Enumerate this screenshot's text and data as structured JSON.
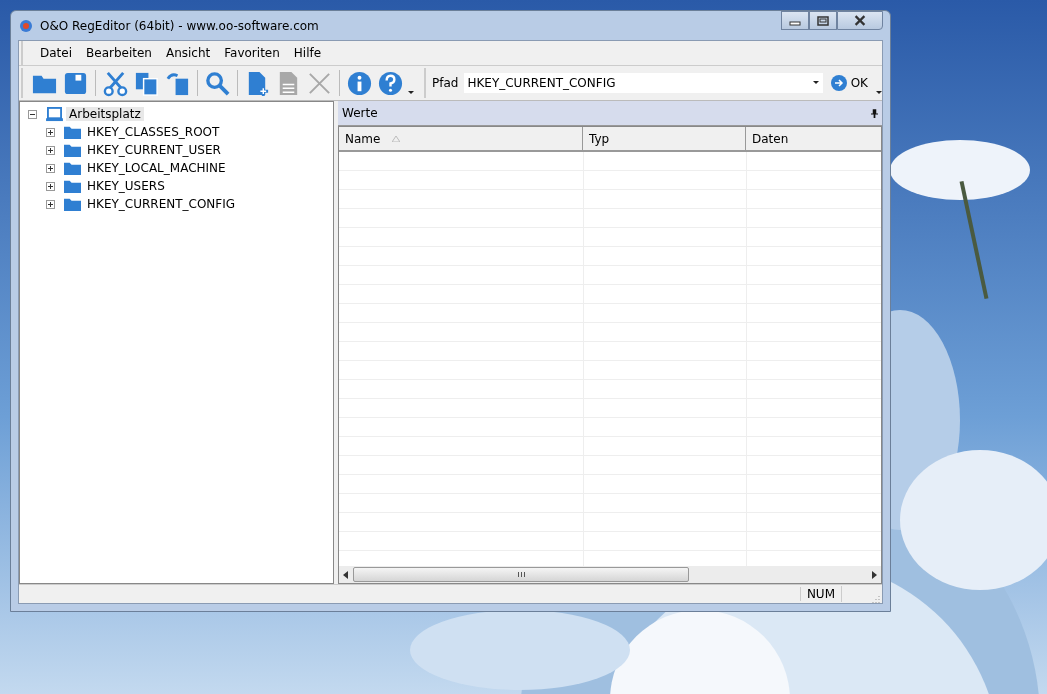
{
  "window": {
    "title": "O&O RegEditor (64bit) - www.oo-software.com"
  },
  "menu": [
    "Datei",
    "Bearbeiten",
    "Ansicht",
    "Favoriten",
    "Hilfe"
  ],
  "toolbar": [
    {
      "kind": "folder",
      "disabled": false
    },
    {
      "kind": "save",
      "disabled": false
    },
    {
      "kind": "sep"
    },
    {
      "kind": "cut",
      "disabled": false
    },
    {
      "kind": "copy",
      "disabled": false
    },
    {
      "kind": "paste",
      "disabled": false
    },
    {
      "kind": "sep"
    },
    {
      "kind": "search",
      "disabled": false
    },
    {
      "kind": "sep"
    },
    {
      "kind": "new",
      "disabled": false
    },
    {
      "kind": "doc",
      "disabled": true
    },
    {
      "kind": "delete",
      "disabled": true
    },
    {
      "kind": "sep"
    },
    {
      "kind": "info",
      "disabled": false
    },
    {
      "kind": "help",
      "disabled": false
    }
  ],
  "path": {
    "label": "Pfad",
    "value": "HKEY_CURRENT_CONFIG",
    "go": "OK"
  },
  "tree": [
    {
      "label": "Arbeitsplatz",
      "selected": true,
      "expanded": true,
      "children": [
        {
          "label": "HKEY_CLASSES_ROOT",
          "selected": false,
          "expanded": false
        },
        {
          "label": "HKEY_CURRENT_USER",
          "selected": false,
          "expanded": false
        },
        {
          "label": "HKEY_LOCAL_MACHINE",
          "selected": false,
          "expanded": false
        },
        {
          "label": "HKEY_USERS",
          "selected": false,
          "expanded": false
        },
        {
          "label": "HKEY_CURRENT_CONFIG",
          "selected": false,
          "expanded": false
        }
      ]
    }
  ],
  "values_panel": {
    "title": "Werte",
    "columns": [
      "Name",
      "Typ",
      "Daten"
    ]
  },
  "status_bar": {
    "num": "NUM"
  }
}
